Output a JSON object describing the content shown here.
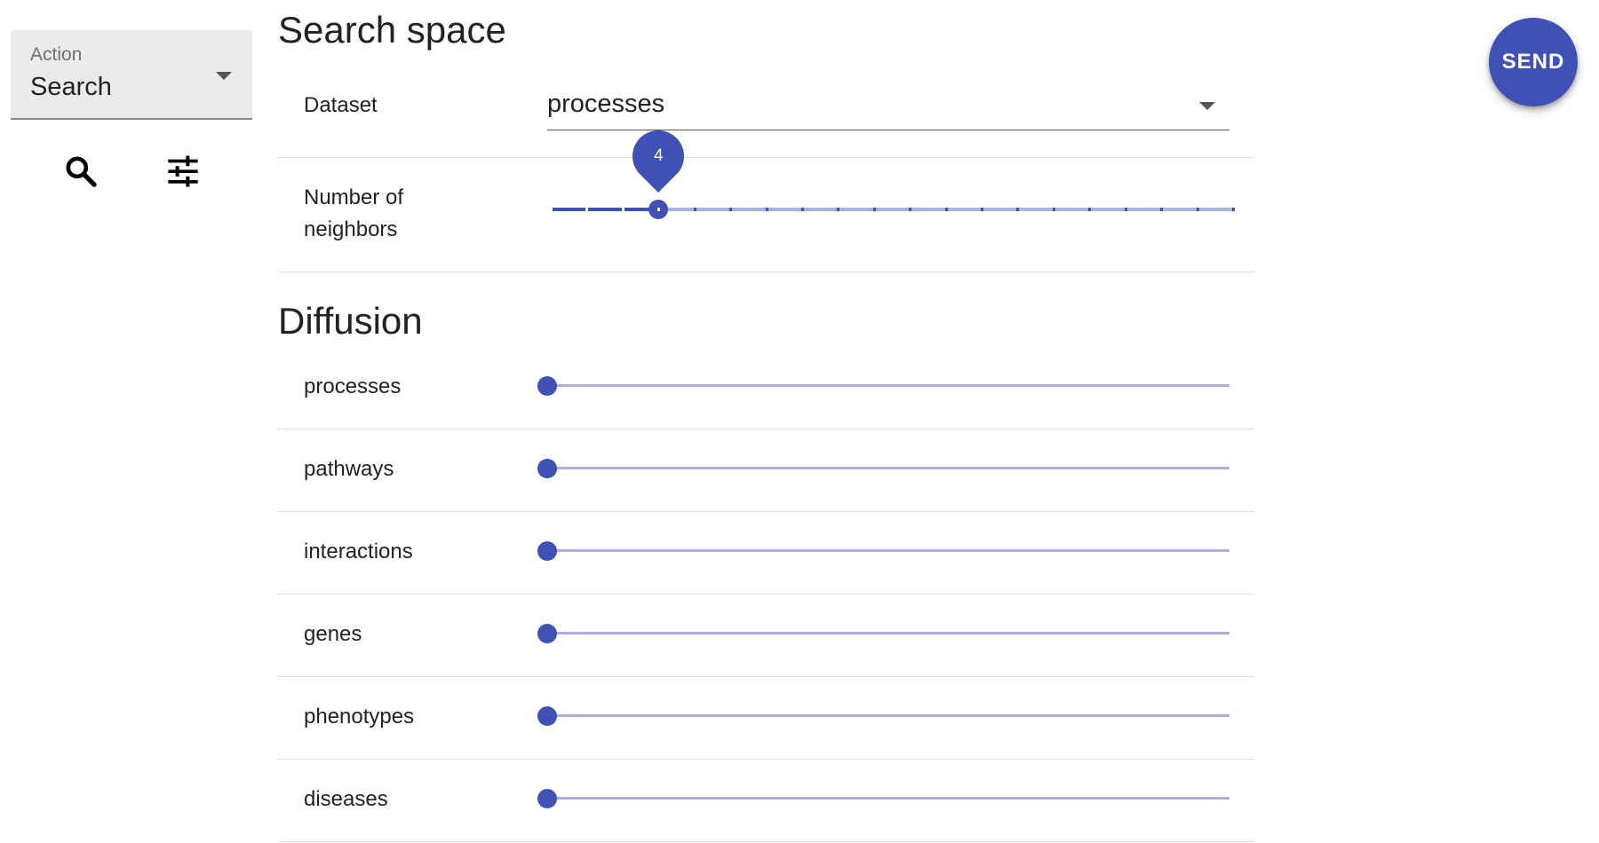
{
  "action": {
    "label": "Action",
    "value": "Search"
  },
  "icons": {
    "search": "search-icon",
    "tune": "tune-icon"
  },
  "search_space": {
    "title": "Search space",
    "dataset": {
      "label": "Dataset",
      "value": "processes"
    },
    "neighbors": {
      "label_line1": "Number of",
      "label_line2": "neighbors",
      "value": 4,
      "min": 1,
      "max": 20
    }
  },
  "diffusion": {
    "title": "Diffusion",
    "items": [
      {
        "label": "processes",
        "value": 0
      },
      {
        "label": "pathways",
        "value": 0
      },
      {
        "label": "interactions",
        "value": 0
      },
      {
        "label": "genes",
        "value": 0
      },
      {
        "label": "phenotypes",
        "value": 0
      },
      {
        "label": "diseases",
        "value": 0
      }
    ]
  },
  "send_label": "SEND",
  "colors": {
    "primary": "#3f51b5",
    "rail": "#aab3df",
    "select_bg": "#ebebeb"
  }
}
